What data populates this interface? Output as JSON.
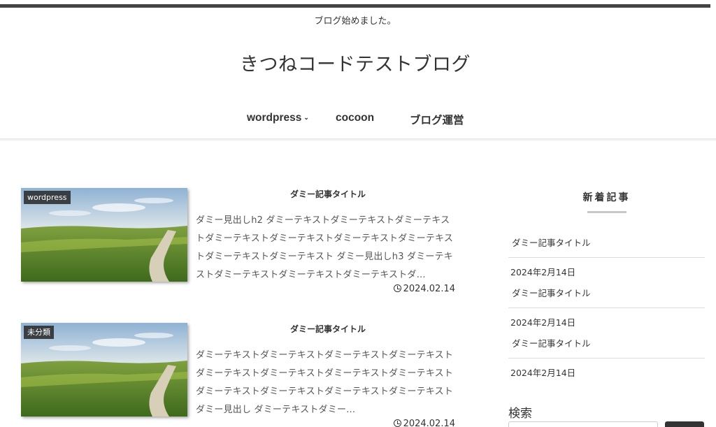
{
  "header": {
    "tagline": "ブログ始めました。",
    "site_title": "きつねコードテストブログ"
  },
  "nav": {
    "items": [
      {
        "label": "wordpress",
        "has_submenu": true
      },
      {
        "label": "cocoon"
      },
      {
        "label": "ブログ運営"
      }
    ]
  },
  "posts": [
    {
      "category": "wordpress",
      "title": "ダミー記事タイトル",
      "excerpt": "ダミー見出しh2 ダミーテキストダミーテキストダミーテキストダミーテキストダミーテキストダミーテキストダミーテキストダミーテキストダミーテキスト ダミー見出しh3 ダミーテキストダミーテキストダミーテキストダミーテキストダ…",
      "date": "2024.02.14"
    },
    {
      "category": "未分類",
      "title": "ダミー記事タイトル",
      "excerpt": "ダミーテキストダミーテキストダミーテキストダミーテキストダミーテキストダミーテキストダミーテキストダミーテキストダミーテキストダミーテキストダミーテキストダミーテキスト ダミー見出し ダミーテキストダミー…",
      "date": "2024.02.14"
    }
  ],
  "sidebar": {
    "recent_title": "新着記事",
    "recent": [
      {
        "title": "ダミー記事タイトル",
        "date": "2024年2月14日"
      },
      {
        "title": "ダミー記事タイトル",
        "date": "2024年2月14日"
      },
      {
        "title": "ダミー記事タイトル",
        "date": "2024年2月14日"
      }
    ],
    "search_title": "検索"
  },
  "colors": {
    "top_bar": "#444444",
    "category_label_bg": "#282828",
    "search_button": "#333333"
  },
  "icons": {
    "chevron": "chevron-down-icon",
    "clock": "clock-icon"
  }
}
